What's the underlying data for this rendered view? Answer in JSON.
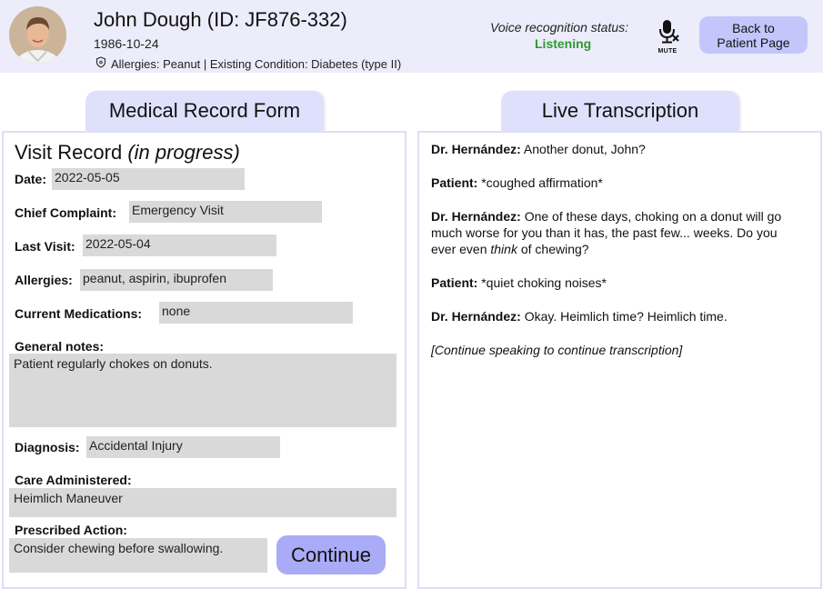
{
  "patient": {
    "name": "John Dough (ID: JF876-332)",
    "dob": "1986-10-24",
    "info": "Allergies: Peanut | Existing Condition: Diabetes (type II)"
  },
  "voice": {
    "label": "Voice recognition status:",
    "status": "Listening",
    "mute_label": "MUTE",
    "status_color": "#2e9a2e"
  },
  "header": {
    "back_line1": "Back to",
    "back_line2": "Patient Page"
  },
  "tabs": {
    "form": "Medical Record Form",
    "transcription": "Live Transcription"
  },
  "form": {
    "title": "Visit Record ",
    "title_status": "(in progress)",
    "fields": {
      "date": {
        "label": "Date:",
        "value": "2022-05-05"
      },
      "chief_complaint": {
        "label": "Chief Complaint:",
        "value": "Emergency Visit"
      },
      "last_visit": {
        "label": "Last Visit:",
        "value": "2022-05-04"
      },
      "allergies": {
        "label": "Allergies:",
        "value": "peanut, aspirin, ibuprofen"
      },
      "medications": {
        "label": "Current Medications:",
        "value": "none"
      },
      "notes": {
        "label": "General notes:",
        "value": "Patient regularly chokes on donuts."
      },
      "diagnosis": {
        "label": "Diagnosis:",
        "value": "Accidental Injury"
      },
      "care": {
        "label": "Care Administered:",
        "value": "Heimlich Maneuver"
      },
      "action": {
        "label": "Prescribed Action:",
        "value": "Consider chewing before swallowing."
      }
    },
    "continue_label": "Continue"
  },
  "transcript": {
    "lines": [
      {
        "speaker": "Dr. Hernández:",
        "text": " Another donut, John?"
      },
      {
        "speaker": "Patient:",
        "text": " *coughed affirmation*"
      },
      {
        "speaker": "Dr. Hernández:",
        "text_a": " One of these days, choking on a donut will go much worse for you than it has, the past few... weeks. Do you ever even ",
        "text_em": "think",
        "text_b": " of chewing?"
      },
      {
        "speaker": "Patient:",
        "text": " *quiet choking noises*"
      },
      {
        "speaker": "Dr. Hernández:",
        "text": " Okay. Heimlich time? Heimlich time."
      }
    ],
    "prompt": "[Continue speaking to continue transcription]"
  },
  "colors": {
    "header_bg": "#ececfb",
    "tab_bg": "#dfe0fb",
    "button_bg": "#c4c6fb",
    "continue_bg": "#a9abf6",
    "field_bg": "#d9d9d9"
  }
}
